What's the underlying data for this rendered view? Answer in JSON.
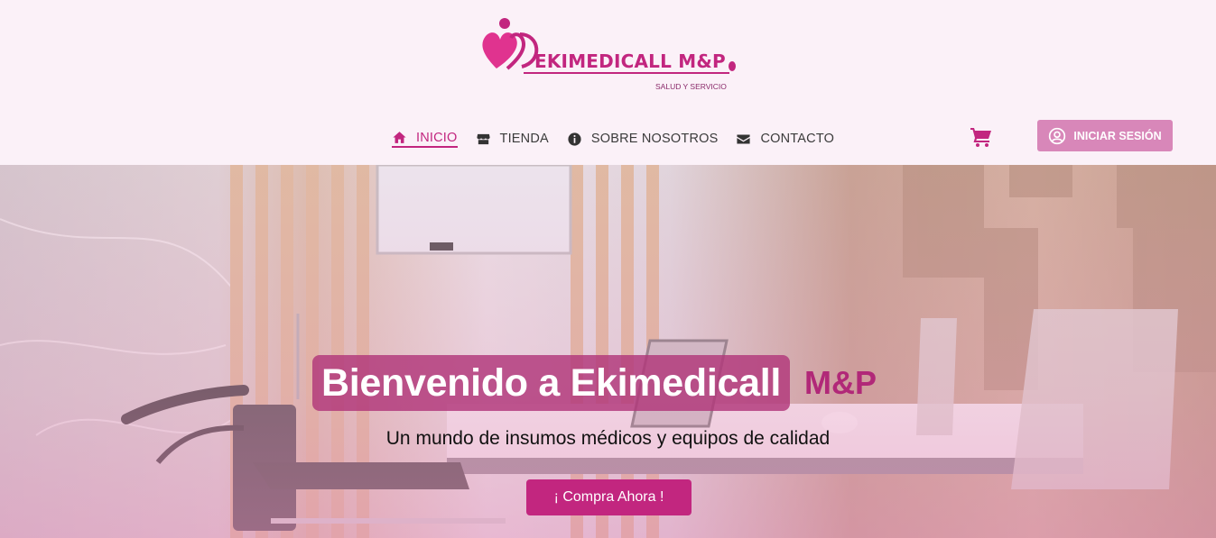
{
  "brand": {
    "name": "EKIMEDICALL M&P",
    "tagline": "SALUD Y SERVICIO"
  },
  "nav": {
    "items": [
      {
        "label": "INICIO",
        "icon": "home-icon",
        "active": true
      },
      {
        "label": "TIENDA",
        "icon": "store-icon",
        "active": false
      },
      {
        "label": "SOBRE NOSOTROS",
        "icon": "info-icon",
        "active": false
      },
      {
        "label": "CONTACTO",
        "icon": "envelope-icon",
        "active": false
      }
    ],
    "cart_icon": "shopping-cart-icon",
    "login_label": "INICIAR SESIÓN",
    "login_icon": "user-circle-icon"
  },
  "hero": {
    "title": "Bienvenido a Ekimedicall",
    "title_brand": "M&P",
    "subtitle": "Un mundo de insumos médicos y equipos de calidad",
    "cta_label": "¡ Compra Ahora !"
  },
  "colors": {
    "accent": "#c2267f",
    "header_bg": "#fbf1f8",
    "login_bg": "#d887b9",
    "title_box": "#b1377a"
  }
}
